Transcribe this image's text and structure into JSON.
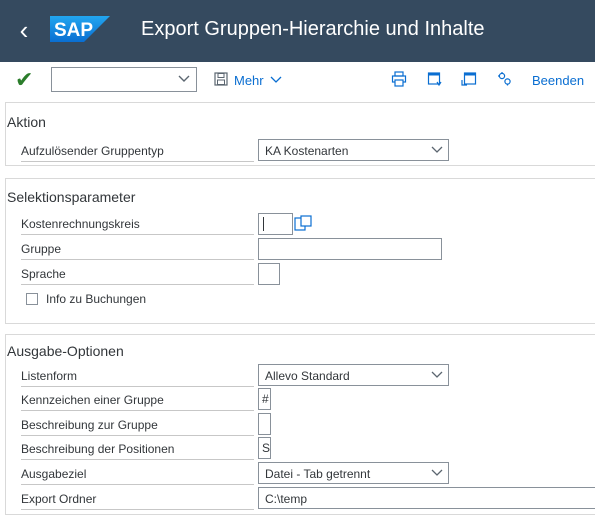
{
  "header": {
    "title": "Export Gruppen-Hierarchie und Inhalte",
    "logo_text": "SAP",
    "back_icon": "chevron-left-icon",
    "bg_color": "#354a5f"
  },
  "toolbar": {
    "command_field_value": "",
    "more_label": "Mehr",
    "exit_label": "Beenden",
    "accent_color": "#0a6ed1"
  },
  "sections": {
    "aktion": {
      "title": "Aktion",
      "rows": [
        {
          "label": "Aufzulösender Gruppentyp",
          "value": "KA Kostenarten"
        }
      ]
    },
    "selektion": {
      "title": "Selektionsparameter",
      "rows": [
        {
          "label": "Kostenrechnungskreis",
          "value": ""
        },
        {
          "label": "Gruppe",
          "value": ""
        },
        {
          "label": "Sprache",
          "value": ""
        }
      ],
      "checkbox_label": "Info zu Buchungen",
      "checkbox_checked": false
    },
    "ausgabe": {
      "title": "Ausgabe-Optionen",
      "rows": [
        {
          "label": "Listenform",
          "value": "Allevo Standard"
        },
        {
          "label": "Kennzeichen einer Gruppe",
          "value": "#"
        },
        {
          "label": "Beschreibung zur Gruppe",
          "value": ""
        },
        {
          "label": "Beschreibung der Positionen",
          "value": "S"
        },
        {
          "label": "Ausgabeziel",
          "value": "Datei - Tab getrennt"
        },
        {
          "label": "Export Ordner",
          "value": "C:\\temp"
        }
      ]
    }
  }
}
